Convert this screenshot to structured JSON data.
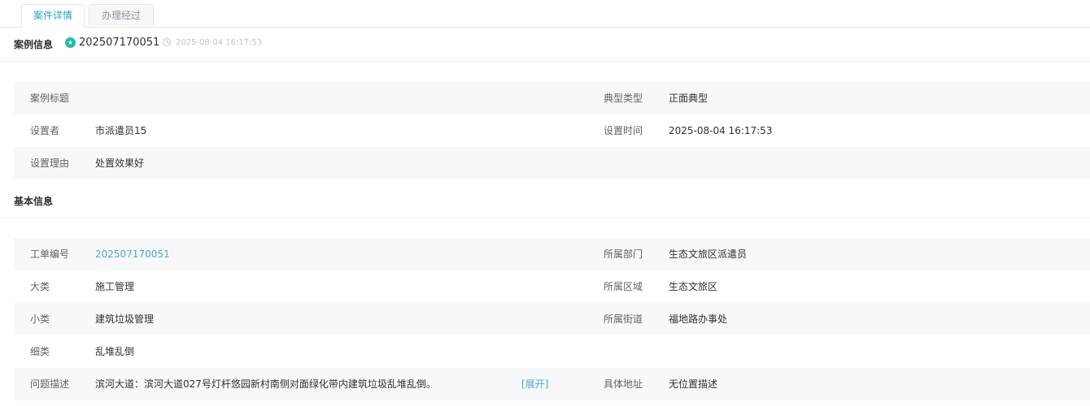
{
  "tabs": [
    {
      "label": "案件详情",
      "active": true
    },
    {
      "label": "办理经过",
      "active": false
    }
  ],
  "case_info": {
    "section_title": "案例信息",
    "number": "202507170051",
    "time": "2025-08-04 16:17:53",
    "rows": [
      {
        "label1": "案例标题",
        "value1": "",
        "label2": "典型类型",
        "value2": "正面典型"
      },
      {
        "label1": "设置者",
        "value1": "市派遣员15",
        "label2": "设置时间",
        "value2": "2025-08-04 16:17:53"
      },
      {
        "label1": "设置理由",
        "value1": "处置效果好",
        "label2": "",
        "value2": ""
      }
    ]
  },
  "basic_info": {
    "section_title": "基本信息",
    "rows": [
      {
        "label1": "工单编号",
        "value1": "202507170051",
        "label2": "所属部门",
        "value2": "生态文旅区派遣员"
      },
      {
        "label1": "大类",
        "value1": "施工管理",
        "label2": "所属区域",
        "value2": "生态文旅区"
      },
      {
        "label1": "小类",
        "value1": "建筑垃圾管理",
        "label2": "所属街道",
        "value2": "福地路办事处"
      },
      {
        "label1": "细类",
        "value1": "乱堆乱倒",
        "label2": "",
        "value2": ""
      },
      {
        "label1": "问题描述",
        "value1": "滨河大道：滨河大道027号灯杆悠园新村南侧对面绿化带内建筑垃圾乱堆乱倒。",
        "expand_label": "[展开]",
        "label2": "具体地址",
        "value2": "无位置描述"
      }
    ]
  },
  "colors": {
    "accent": "#26a6c4",
    "link": "#4fa8d0",
    "badge": "#1fbf9c"
  }
}
